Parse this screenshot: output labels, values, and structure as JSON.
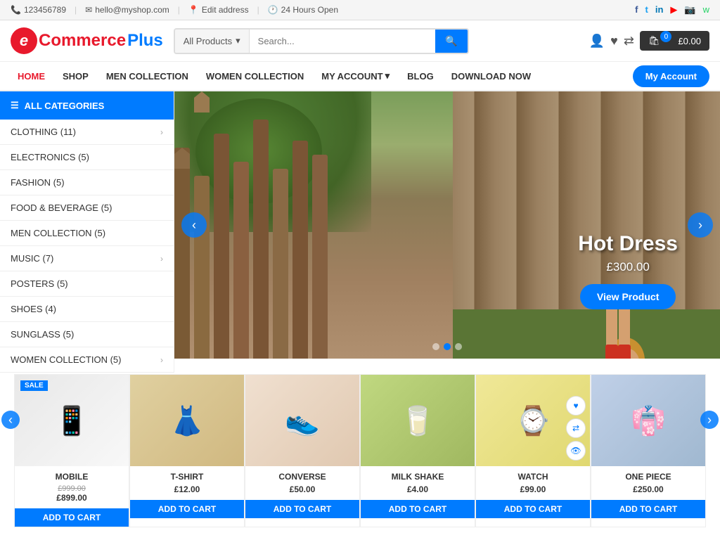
{
  "topbar": {
    "phone": "123456789",
    "email": "hello@myshop.com",
    "address_link": "Edit address",
    "hours": "24 Hours Open",
    "social": [
      {
        "name": "facebook",
        "icon": "f"
      },
      {
        "name": "twitter",
        "icon": "t"
      },
      {
        "name": "linkedin",
        "icon": "in"
      },
      {
        "name": "youtube",
        "icon": "▶"
      },
      {
        "name": "instagram",
        "icon": "📷"
      },
      {
        "name": "whatsapp",
        "icon": "w"
      }
    ]
  },
  "header": {
    "logo_letter": "e",
    "logo_name": "Commerce",
    "logo_plus": " Plus",
    "search_placeholder": "Search...",
    "search_category": "All Products",
    "cart_amount": "£0.00",
    "cart_count": "0"
  },
  "nav": {
    "items": [
      {
        "label": "HOME",
        "active": true
      },
      {
        "label": "SHOP",
        "active": false
      },
      {
        "label": "MEN COLLECTION",
        "active": false
      },
      {
        "label": "WOMEN COLLECTION",
        "active": false
      },
      {
        "label": "MY ACCOUNT",
        "active": false,
        "has_dropdown": true
      },
      {
        "label": "BLOG",
        "active": false
      },
      {
        "label": "DOWNLOAD NOW",
        "active": false
      }
    ],
    "account_btn": "My Account"
  },
  "sidebar": {
    "header": "ALL CATEGORIES",
    "items": [
      {
        "label": "CLOTHING (11)",
        "has_arrow": true
      },
      {
        "label": "ELECTRONICS (5)",
        "has_arrow": false
      },
      {
        "label": "FASHION (5)",
        "has_arrow": false
      },
      {
        "label": "FOOD & BEVERAGE (5)",
        "has_arrow": false
      },
      {
        "label": "MEN COLLECTION (5)",
        "has_arrow": false
      },
      {
        "label": "MUSIC (7)",
        "has_arrow": true
      },
      {
        "label": "POSTERS (5)",
        "has_arrow": false
      },
      {
        "label": "SHOES (4)",
        "has_arrow": false
      },
      {
        "label": "SUNGLASS (5)",
        "has_arrow": false
      },
      {
        "label": "WOMEN COLLECTION (5)",
        "has_arrow": true
      }
    ]
  },
  "hero": {
    "title": "Hot Dress",
    "price": "£300.00",
    "btn": "View Product",
    "dots": 3,
    "active_dot": 1
  },
  "products": {
    "prev_label": "‹",
    "next_label": "›",
    "items": [
      {
        "name": "MOBILE",
        "price_old": "£999.00",
        "price": "£899.00",
        "sale": true,
        "img_type": "mobile",
        "icon": "📱"
      },
      {
        "name": "T-SHIRT",
        "price_old": "",
        "price": "£12.00",
        "sale": false,
        "img_type": "tshirt",
        "icon": "👗"
      },
      {
        "name": "CONVERSE",
        "price_old": "",
        "price": "£50.00",
        "sale": false,
        "img_type": "converse",
        "icon": "👟"
      },
      {
        "name": "MILK SHAKE",
        "price_old": "",
        "price": "£4.00",
        "sale": false,
        "img_type": "milkshake",
        "icon": "🥛"
      },
      {
        "name": "WATCH",
        "price_old": "",
        "price": "£99.00",
        "sale": false,
        "img_type": "watch",
        "icon": "⌚",
        "has_icons": true
      },
      {
        "name": "ONE PIECE",
        "price_old": "",
        "price": "£250.00",
        "sale": false,
        "img_type": "onepiece",
        "icon": "👘"
      }
    ],
    "sale_label": "SALE",
    "product_icons": [
      "♥",
      "⇄",
      "🔍"
    ]
  }
}
